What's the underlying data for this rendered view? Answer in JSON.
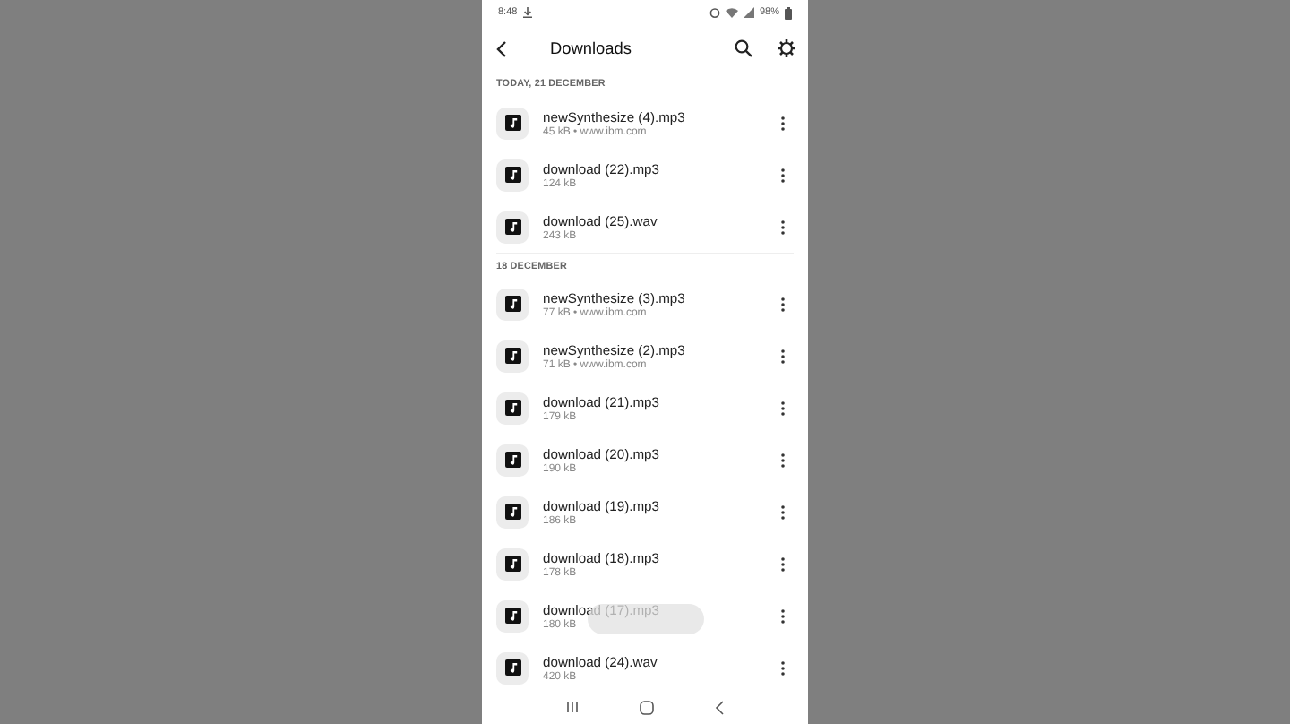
{
  "status_bar": {
    "time": "8:48",
    "battery": "98%"
  },
  "app_bar": {
    "title": "Downloads"
  },
  "sections": [
    {
      "header": "TODAY, 21 DECEMBER",
      "items": [
        {
          "name": "newSynthesize (4).mp3",
          "details": "45 kB • www.ibm.com"
        },
        {
          "name": "download (22).mp3",
          "details": "124 kB"
        },
        {
          "name": "download (25).wav",
          "details": "243 kB"
        }
      ]
    },
    {
      "header": "18 DECEMBER",
      "items": [
        {
          "name": "newSynthesize (3).mp3",
          "details": "77 kB • www.ibm.com"
        },
        {
          "name": "newSynthesize (2).mp3",
          "details": "71 kB • www.ibm.com"
        },
        {
          "name": "download (21).mp3",
          "details": "179 kB"
        },
        {
          "name": "download (20).mp3",
          "details": "190 kB"
        },
        {
          "name": "download (19).mp3",
          "details": "186 kB"
        },
        {
          "name": "download (18).mp3",
          "details": "178 kB"
        },
        {
          "name": "download (17).mp3",
          "details": "180 kB"
        },
        {
          "name": "download (24).wav",
          "details": "420 kB"
        }
      ]
    }
  ]
}
